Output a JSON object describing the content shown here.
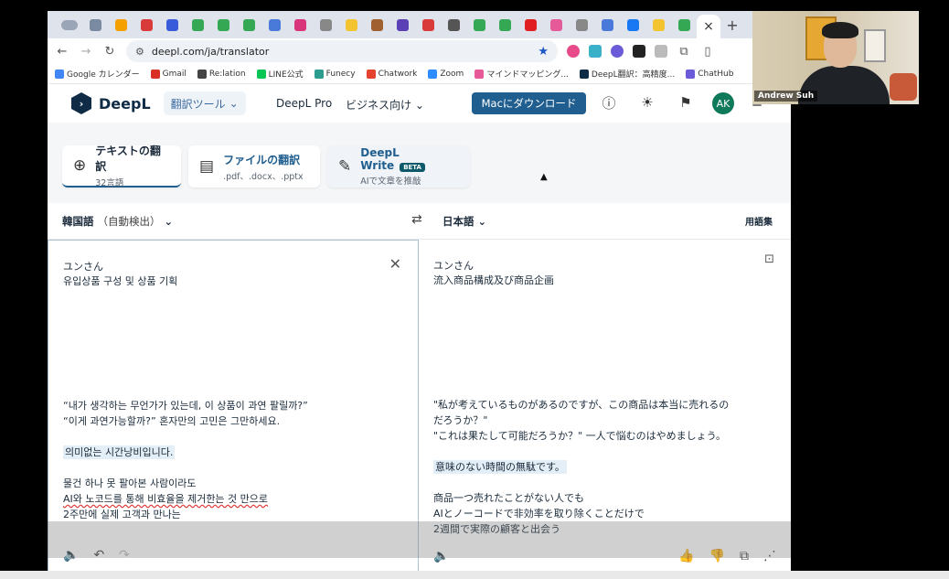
{
  "browser": {
    "url": "deepl.com/ja/translator",
    "tab_favicon_colors": [
      "#7a8aa0",
      "#f4a100",
      "#d93b3b",
      "#3a5bd9",
      "#34a853",
      "#34a853",
      "#34a853",
      "#4a7ad9",
      "#d8357a",
      "#888888",
      "#f4c430",
      "#a06030",
      "#5a3fb5",
      "#d93b3b",
      "#555555",
      "#34a853",
      "#34a853",
      "#e02020",
      "#e65a9a",
      "#888888",
      "#4a7ad9",
      "#1877f2",
      "#f4c430",
      "#34a853"
    ],
    "active_tab_close": "×",
    "new_tab": "+",
    "bookmarks": [
      {
        "label": "Google カレンダー",
        "color": "#4285f4"
      },
      {
        "label": "Gmail",
        "color": "#d93025"
      },
      {
        "label": "Re:lation",
        "color": "#444444"
      },
      {
        "label": "LINE公式",
        "color": "#06c755"
      },
      {
        "label": "Funecy",
        "color": "#2a9d8f"
      },
      {
        "label": "Chatwork",
        "color": "#e6432f"
      },
      {
        "label": "Zoom",
        "color": "#2d8cff"
      },
      {
        "label": "マインドマッピング...",
        "color": "#e65a9a"
      },
      {
        "label": "DeepL翻訳：高精度...",
        "color": "#0f2b46"
      },
      {
        "label": "ChatHub",
        "color": "#6b5bd9"
      }
    ]
  },
  "header": {
    "logo_text": "DeepL",
    "tool_dropdown": "翻訳ツール",
    "pro_link": "DeepL Pro",
    "business_link": "ビジネス向け",
    "download_button": "Macにダウンロード",
    "avatar_initials": "AK"
  },
  "modes": {
    "text": {
      "title": "テキストの翻訳",
      "sub": "32言語"
    },
    "file": {
      "title": "ファイルの翻訳",
      "sub": ".pdf、.docx、.pptx"
    },
    "write": {
      "title": "DeepL Write",
      "badge": "BETA",
      "sub": "AIで文章を推敲"
    }
  },
  "langbar": {
    "source": "韓国語",
    "source_detect": "（自動検出）",
    "target": "日本語",
    "glossary": "用語集"
  },
  "source_panel": {
    "lines": [
      "ユンさん",
      "유입상품 구성 및 상품 기획",
      "“내가 생각하는 무언가가 있는데, 이 상품이 과연 팔릴까?”",
      "“이게 과연가능할까?” 혼자만의 고민은 그만하세요.",
      "의미없는 시간낭비입니다.",
      "물건 하나 못 팔아본 사람이라도",
      "AI와 노코드를 통해 비효율을 제거한는 것 만으로",
      "2주만에 실제 고객과 만나는"
    ]
  },
  "target_panel": {
    "lines": [
      "ユンさん",
      "流入商品構成及び商品企画",
      "\"私が考えているものがあるのですが、この商品は本当に売れるの",
      "だろうか？\"",
      "\"これは果たして可能だろうか？\" 一人で悩むのはやめましょう。",
      "意味のない時間の無駄です。",
      "商品一つ売れたことがない人でも",
      "AIとノーコードで非効率を取り除くことだけで",
      "2週間で実際の顧客と出会う"
    ]
  },
  "webcam": {
    "name": "Andrew Suh"
  }
}
